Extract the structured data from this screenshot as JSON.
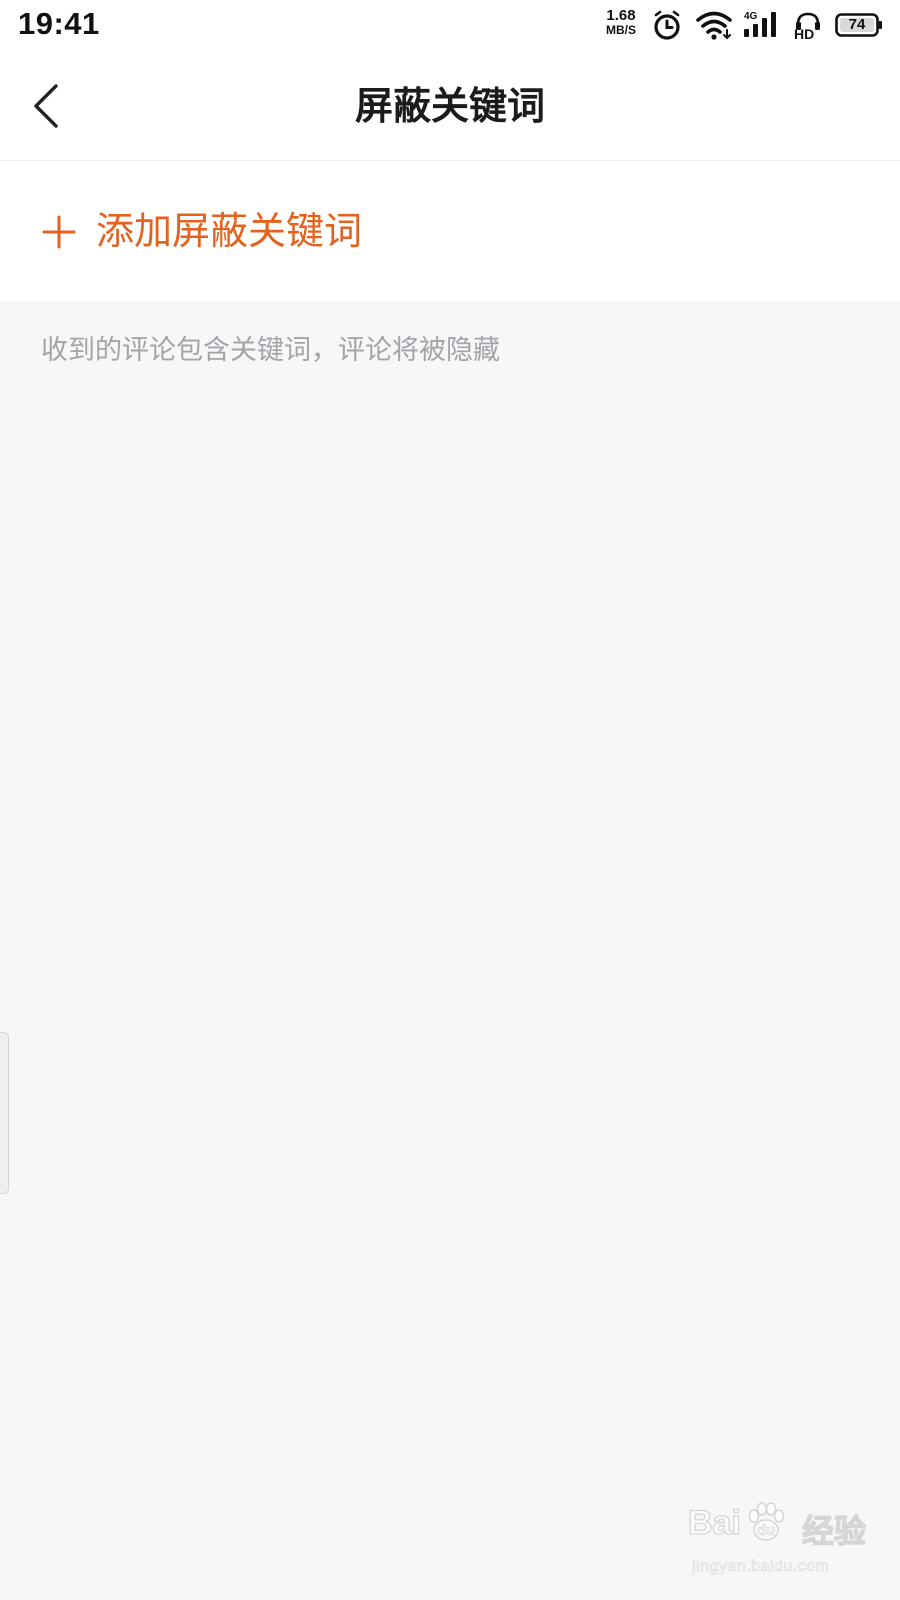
{
  "status_bar": {
    "time": "19:41",
    "net_speed_value": "1.68",
    "net_speed_unit": "MB/S",
    "signal_type": "4G",
    "hd_label": "HD",
    "battery_level": "74",
    "icons": [
      "alarm-icon",
      "wifi-icon",
      "signal-icon",
      "hd-icon",
      "battery-icon"
    ]
  },
  "nav": {
    "title": "屏蔽关键词",
    "back_icon": "chevron-left-icon"
  },
  "add_row": {
    "icon": "plus-icon",
    "label": "添加屏蔽关键词",
    "accent_color": "#e4621d"
  },
  "hint": "收到的评论包含关键词，评论将被隐藏",
  "watermark": {
    "brand_left": "Bai",
    "brand_right": "du",
    "product": "经验",
    "url": "jingyan.baidu.com"
  },
  "colors": {
    "page_background": "#f7f6f9",
    "card_background": "#ffffff",
    "title_text": "#1b1b1b",
    "hint_text": "#a3a3a8"
  }
}
